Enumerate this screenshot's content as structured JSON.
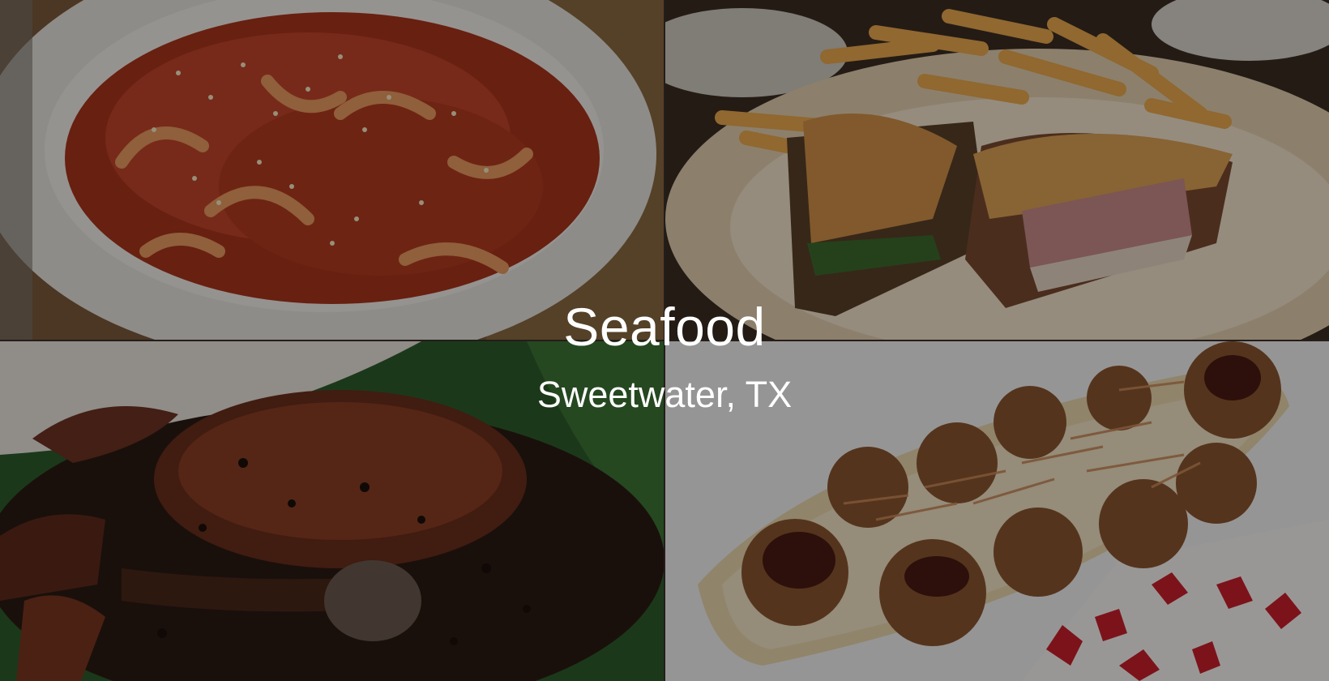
{
  "overlay": {
    "title": "Seafood",
    "subtitle": "Sweetwater, TX"
  },
  "photos": [
    {
      "name": "spicy-stir-fried-squid-photo"
    },
    {
      "name": "sandwich-and-fries-photo"
    },
    {
      "name": "black-pepper-crab-photo"
    },
    {
      "name": "takoyaki-photo"
    }
  ]
}
